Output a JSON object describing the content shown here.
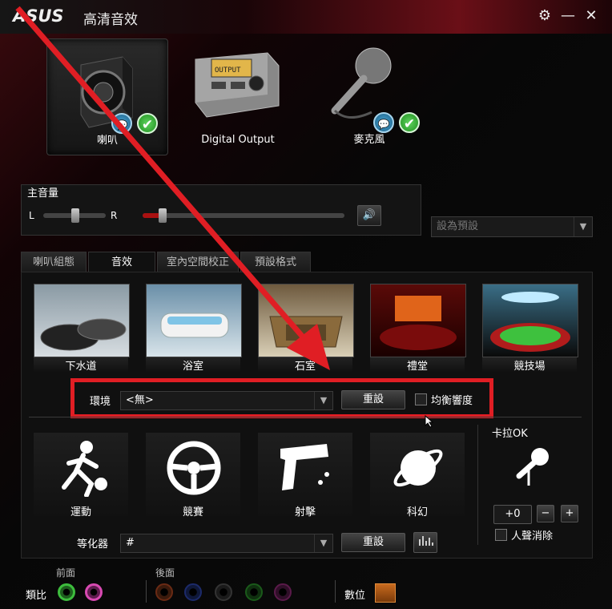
{
  "window": {
    "logo": "ASUS",
    "title": "高清音效"
  },
  "devices": [
    {
      "label": "喇叭",
      "selected": true,
      "default": true,
      "chat": true
    },
    {
      "label": "Digital Output",
      "selected": false
    },
    {
      "label": "麥克風",
      "selected": false,
      "default": true,
      "chat": true
    }
  ],
  "volume": {
    "title": "主音量",
    "left": "L",
    "right": "R"
  },
  "default_select": {
    "value": "設為預設"
  },
  "tabs": [
    "喇叭組態",
    "音效",
    "室內空間校正",
    "預設格式"
  ],
  "presets": [
    "下水道",
    "浴室",
    "石室",
    "禮堂",
    "競技場"
  ],
  "environment": {
    "label": "環境",
    "value": "<無>",
    "reset": "重設",
    "equalize": "均衡響度"
  },
  "effects": [
    "運動",
    "競賽",
    "射擊",
    "科幻"
  ],
  "karaoke": {
    "title": "卡拉OK",
    "value": "+0",
    "minus": "−",
    "plus": "+",
    "vocal_cancel": "人聲消除"
  },
  "equalizer": {
    "label": "等化器",
    "value": "#",
    "reset": "重設"
  },
  "jacks": {
    "front": "前面",
    "rear": "後面",
    "analog": "類比",
    "digital": "數位"
  },
  "colors": {
    "accent": "#e01e24",
    "check": "#2fa82f"
  }
}
